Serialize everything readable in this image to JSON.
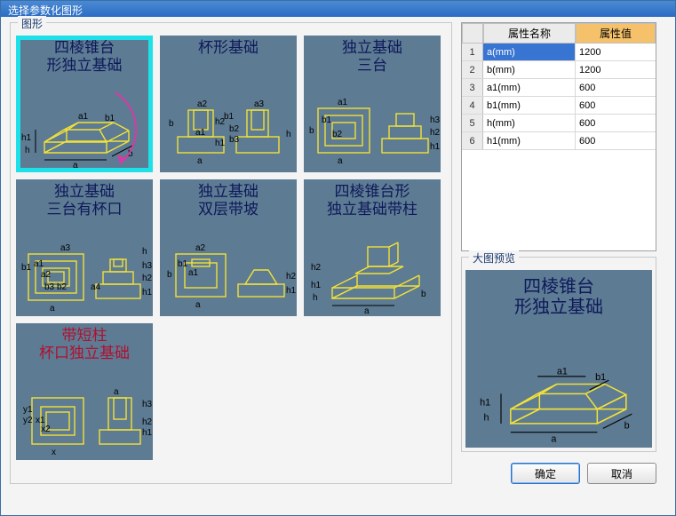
{
  "window": {
    "title": "选择参数化图形"
  },
  "shapes_group_label": "图形",
  "preview_label": "大图预览",
  "table": {
    "headers": {
      "name": "属性名称",
      "value": "属性值"
    },
    "rows": [
      {
        "n": "1",
        "name": "a(mm)",
        "value": "1200",
        "selected": true
      },
      {
        "n": "2",
        "name": "b(mm)",
        "value": "1200"
      },
      {
        "n": "3",
        "name": "a1(mm)",
        "value": "600"
      },
      {
        "n": "4",
        "name": "b1(mm)",
        "value": "600"
      },
      {
        "n": "5",
        "name": "h(mm)",
        "value": "600"
      },
      {
        "n": "6",
        "name": "h1(mm)",
        "value": "600"
      }
    ]
  },
  "shapes": [
    {
      "id": "s1",
      "title": "四棱锥台\n形独立基础",
      "selected": true
    },
    {
      "id": "s2",
      "title": "杯形基础"
    },
    {
      "id": "s3",
      "title": "独立基础\n三台"
    },
    {
      "id": "s4",
      "title": "独立基础\n三台有杯口"
    },
    {
      "id": "s5",
      "title": "独立基础\n双层带坡"
    },
    {
      "id": "s6",
      "title": "四棱锥台形\n独立基础带柱"
    },
    {
      "id": "s7",
      "title": "带短柱\n杯口独立基础",
      "red": true
    }
  ],
  "preview": {
    "title": "四棱锥台\n形独立基础"
  },
  "buttons": {
    "ok": "确定",
    "cancel": "取消"
  }
}
